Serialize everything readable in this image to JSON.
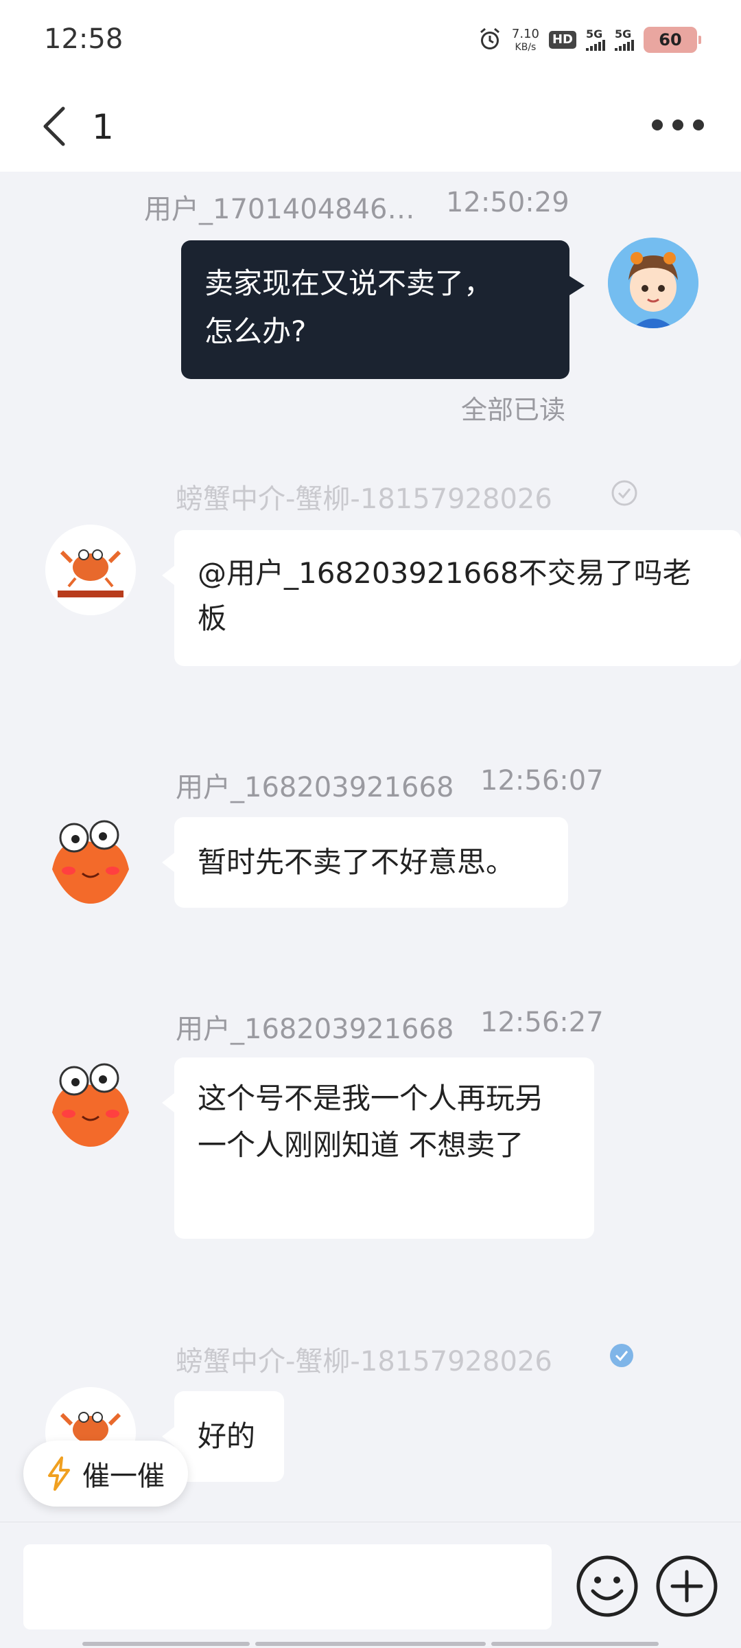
{
  "status_bar": {
    "time": "12:58",
    "net_speed_value": "7.10",
    "net_speed_unit": "KB/s",
    "hd_label": "HD",
    "signal1_label": "5G",
    "signal2_label": "5G",
    "battery": "60"
  },
  "header": {
    "title": "1"
  },
  "messages": [
    {
      "sender": "用户_1701404846…",
      "time": "12:50:29",
      "text_line1": "卖家现在又说不卖了，",
      "text_line2": "怎么办?",
      "status": "全部已读"
    },
    {
      "sender": "螃蟹中介-蟹柳-18157928026",
      "text": "@用户_168203921668不交易了吗老板"
    },
    {
      "sender": "用户_168203921668",
      "time": "12:56:07",
      "text": "暂时先不卖了不好意思。"
    },
    {
      "sender": "用户_168203921668",
      "time": "12:56:27",
      "text": "这个号不是我一个人再玩另一个人刚刚知道 不想卖了"
    },
    {
      "sender": "螃蟹中介-蟹柳-18157928026",
      "text": "好的"
    }
  ],
  "nudge": {
    "label": "催一催"
  },
  "input": {
    "placeholder": ""
  },
  "colors": {
    "background": "#f2f3f7",
    "dark_bubble": "#1b2330",
    "verify_blue": "#4a90e2"
  }
}
